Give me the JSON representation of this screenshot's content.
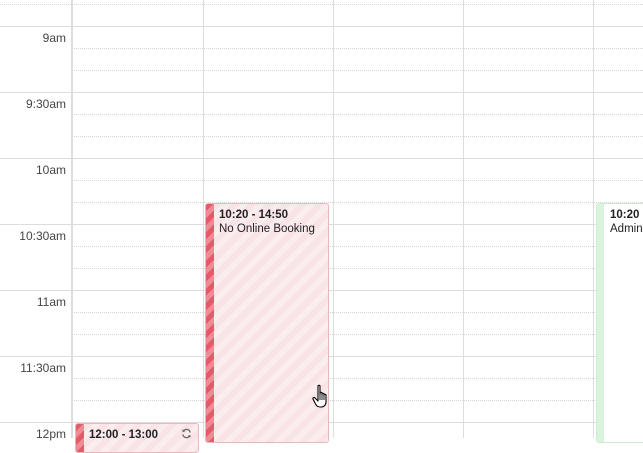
{
  "time_labels": [
    "9am",
    "9:30am",
    "10am",
    "10:30am",
    "11am",
    "11:30am",
    "12pm"
  ],
  "events": [
    {
      "time": "10:20 - 14:50",
      "title": "No Online Booking",
      "color": "#e45a68"
    },
    {
      "time": "10:20",
      "title": "Admin",
      "color": "#d9f4dc"
    },
    {
      "time": "12:00 - 13:00",
      "title": "",
      "color": "#e45a68",
      "icon": "sync-icon"
    }
  ],
  "cursor": {
    "icon": "hand-pointer-icon"
  }
}
